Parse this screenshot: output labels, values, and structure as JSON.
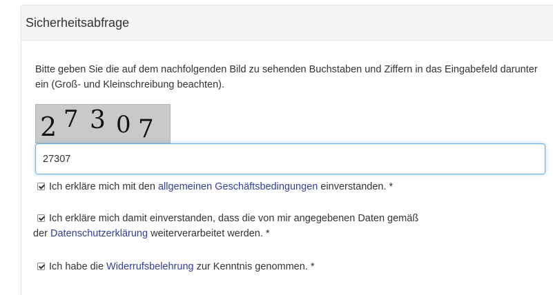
{
  "panel": {
    "title": "Sicherheitsabfrage"
  },
  "intro": {
    "text": "Bitte geben Sie die auf dem nachfolgenden Bild zu sehenden Buchstaben und Ziffern in das Eingabefeld darunter ein (Groß- und Kleinschreibung beachten)."
  },
  "captcha": {
    "characters": [
      "2",
      "7",
      "3",
      "0",
      "7"
    ]
  },
  "input": {
    "value": "27307"
  },
  "checkboxes": [
    {
      "prefix": "Ich erkläre mich mit den ",
      "link": "allgemeinen Geschäftsbedingungen",
      "suffix": " einverstanden. *",
      "checked": true
    },
    {
      "prefix": "Ich erkläre mich damit einverstanden, dass die von mir angegebenen Daten gemäß",
      "prefix2": "der ",
      "link": "Datenschutzerklärung",
      "suffix": " weiterverarbeitet werden. *",
      "checked": true
    },
    {
      "prefix": "Ich habe die ",
      "link": "Widerrufsbelehrung",
      "suffix": " zur Kenntnis genommen. *",
      "checked": true
    }
  ]
}
